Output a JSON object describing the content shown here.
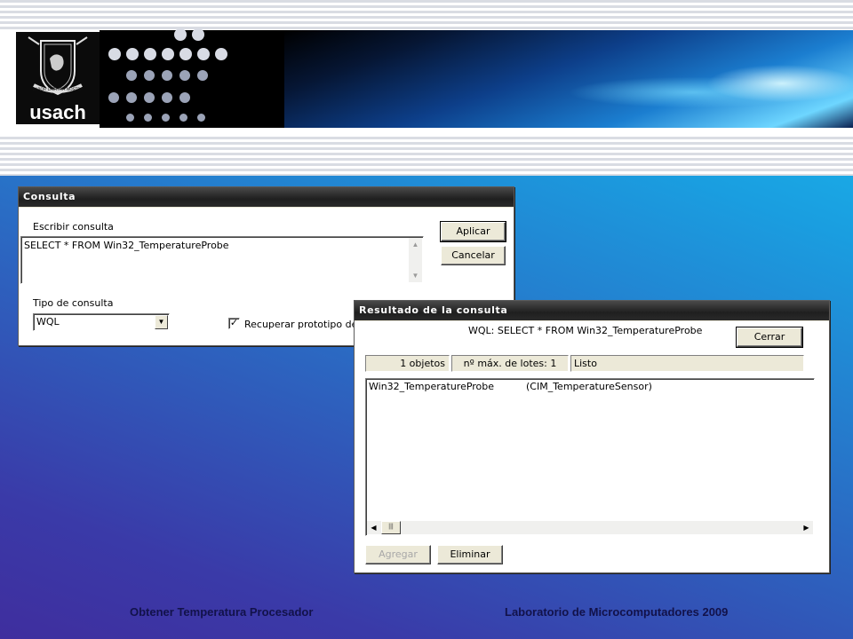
{
  "header": {
    "logo_text": "usach",
    "logo_motto": "LABOR LAETITIA NOSTRA"
  },
  "query_dialog": {
    "title": "Consulta",
    "write_query_label": "Escribir consulta",
    "query_text": "SELECT * FROM Win32_TemperatureProbe",
    "apply_button": "Aplicar",
    "cancel_button": "Cancelar",
    "query_type_label": "Tipo de consulta",
    "query_type_value": "WQL",
    "retrieve_prototype_label": "Recuperar prototipo de cla",
    "retrieve_prototype_checked": true
  },
  "result_dialog": {
    "title": "Resultado de la consulta",
    "query_summary": "WQL: SELECT * FROM Win32_TemperatureProbe",
    "close_button": "Cerrar",
    "status": {
      "objects": "1 objetos",
      "max_batch": "nº máx. de lotes: 1",
      "state": "Listo"
    },
    "results": [
      {
        "name": "Win32_TemperatureProbe",
        "class": "(CIM_TemperatureSensor)"
      }
    ],
    "add_button": "Agregar",
    "delete_button": "Eliminar"
  },
  "footer": {
    "left": "Obtener Temperatura Procesador",
    "right": "Laboratorio de Microcomputadores 2009"
  }
}
